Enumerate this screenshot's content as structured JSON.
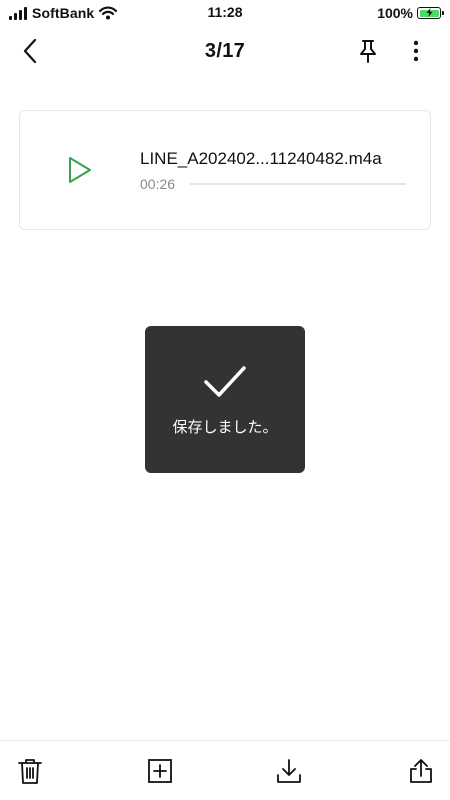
{
  "status_bar": {
    "carrier": "SoftBank",
    "time": "11:28",
    "battery_percent": "100%",
    "battery_level": 1.0,
    "battery_color": "#4cd964"
  },
  "header": {
    "back_icon": "chevron-left-icon",
    "page_counter": "3/17",
    "pin_icon": "pin-icon",
    "more_icon": "more-vertical-icon"
  },
  "audio": {
    "play_icon": "play-icon",
    "play_color": "#3aa14a",
    "file_name": "LINE_A202402...11240482.m4a",
    "duration": "00:26",
    "progress": 0
  },
  "toast": {
    "icon": "checkmark-icon",
    "message": "保存しました。",
    "background": "#333333"
  },
  "toolbar": {
    "items": [
      {
        "name": "delete",
        "icon": "trash-icon"
      },
      {
        "name": "add",
        "icon": "plus-square-icon"
      },
      {
        "name": "download",
        "icon": "download-icon"
      },
      {
        "name": "share",
        "icon": "share-icon"
      }
    ]
  }
}
